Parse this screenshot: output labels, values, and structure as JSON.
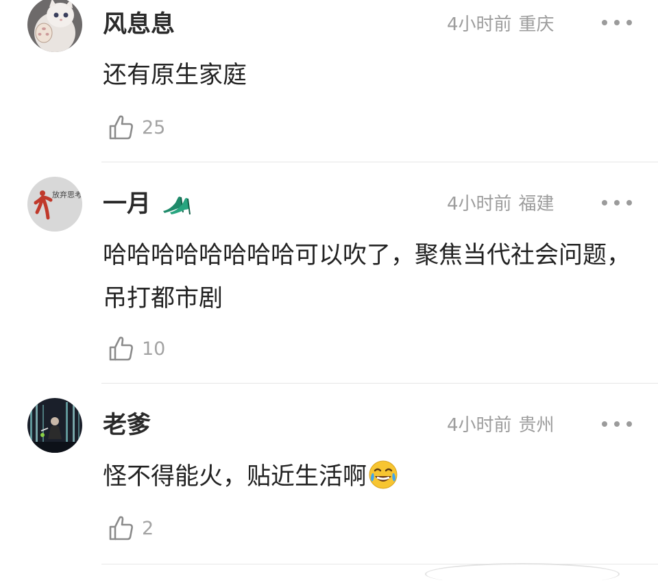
{
  "comments": [
    {
      "username": "风息息",
      "time": "4小时前",
      "location": "重庆",
      "text": "还有原生家庭",
      "likes": "25",
      "avatar": "cat-avatar"
    },
    {
      "username": "一月",
      "badge": "high-heels-emoji",
      "time": "4小时前",
      "location": "福建",
      "text": "哈哈哈哈哈哈哈哈可以吹了，聚焦当代社会问题，吊打都市剧",
      "likes": "10",
      "avatar": "doodle-avatar"
    },
    {
      "username": "老爹",
      "time": "4小时前",
      "location": "贵州",
      "text": "怪不得能火，贴近生活啊",
      "emoji": "tears-of-joy-emoji",
      "likes": "2",
      "avatar": "stage-avatar"
    }
  ],
  "colors": {
    "text": "#222222",
    "meta": "#9c9c9c",
    "divider": "#e6e6e6"
  }
}
